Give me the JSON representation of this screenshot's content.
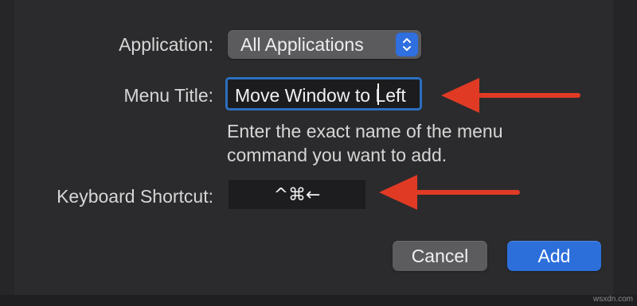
{
  "dialog": {
    "application_label": "Application:",
    "application_value": "All Applications",
    "menu_title_label": "Menu Title:",
    "menu_title_value": "Move Window to Left",
    "help_text": "Enter the exact name of the menu command you want to add.",
    "shortcut_label": "Keyboard Shortcut:",
    "shortcut_value": "^⌘←",
    "cancel_label": "Cancel",
    "add_label": "Add"
  },
  "annotations": {
    "arrow_color": "#e03a25"
  },
  "watermark": "wsxdn.com",
  "colors": {
    "accent": "#2c6fdb",
    "focus_ring": "#2b6fbf",
    "background": "#2b2b2d"
  },
  "icons": {
    "popup_stepper": "chevron-up-down-icon",
    "annotation_arrow": "left-arrow-icon"
  }
}
